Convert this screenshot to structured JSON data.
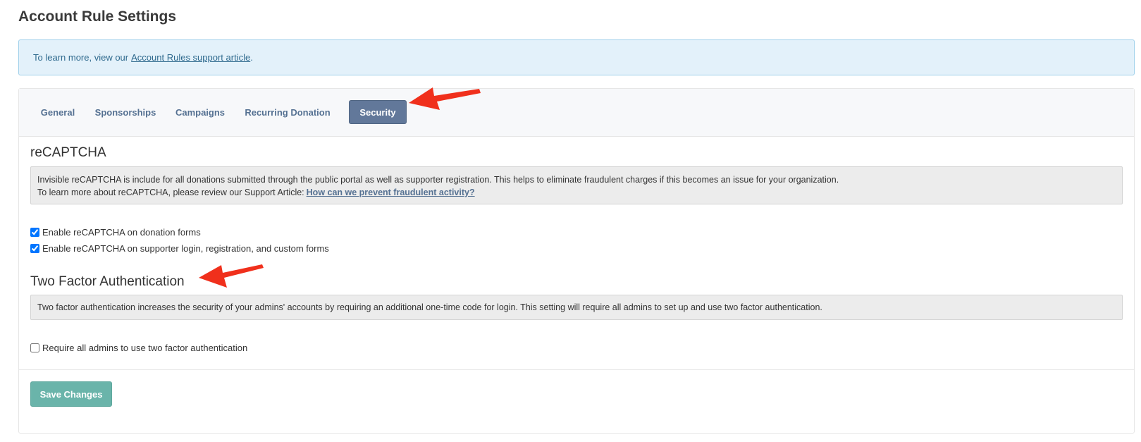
{
  "page": {
    "title": "Account Rule Settings"
  },
  "banner": {
    "text": "To learn more, view our",
    "link_text": "Account Rules support article",
    "suffix": "."
  },
  "tabs": [
    {
      "label": "General",
      "active": false
    },
    {
      "label": "Sponsorships",
      "active": false
    },
    {
      "label": "Campaigns",
      "active": false
    },
    {
      "label": "Recurring Donation",
      "active": false
    },
    {
      "label": "Security",
      "active": true
    }
  ],
  "recaptcha": {
    "heading": "reCAPTCHA",
    "note_line1": "Invisible reCAPTCHA is include for all donations submitted through the public portal as well as supporter registration. This helps to eliminate fraudulent charges if this becomes an issue for your organization.",
    "note_line2": "To learn more about reCAPTCHA, please review our Support Article:",
    "note_link": "How can we prevent fraudulent activity?",
    "options": [
      {
        "label": "Enable reCAPTCHA on donation forms",
        "checked": true
      },
      {
        "label": "Enable reCAPTCHA on supporter login, registration, and custom forms",
        "checked": true
      }
    ]
  },
  "two_factor": {
    "heading": "Two Factor Authentication",
    "note": "Two factor authentication increases the security of your admins' accounts by requiring an additional one-time code for login. This setting will require all admins to set up and use two factor authentication.",
    "option": {
      "label": "Require all admins to use two factor authentication",
      "checked": false
    }
  },
  "actions": {
    "save_label": "Save Changes"
  },
  "colors": {
    "arrow": "#f0301c",
    "active_tab": "#62789a",
    "save_button": "#6ab4aa",
    "banner_bg": "#e3f1fa"
  }
}
